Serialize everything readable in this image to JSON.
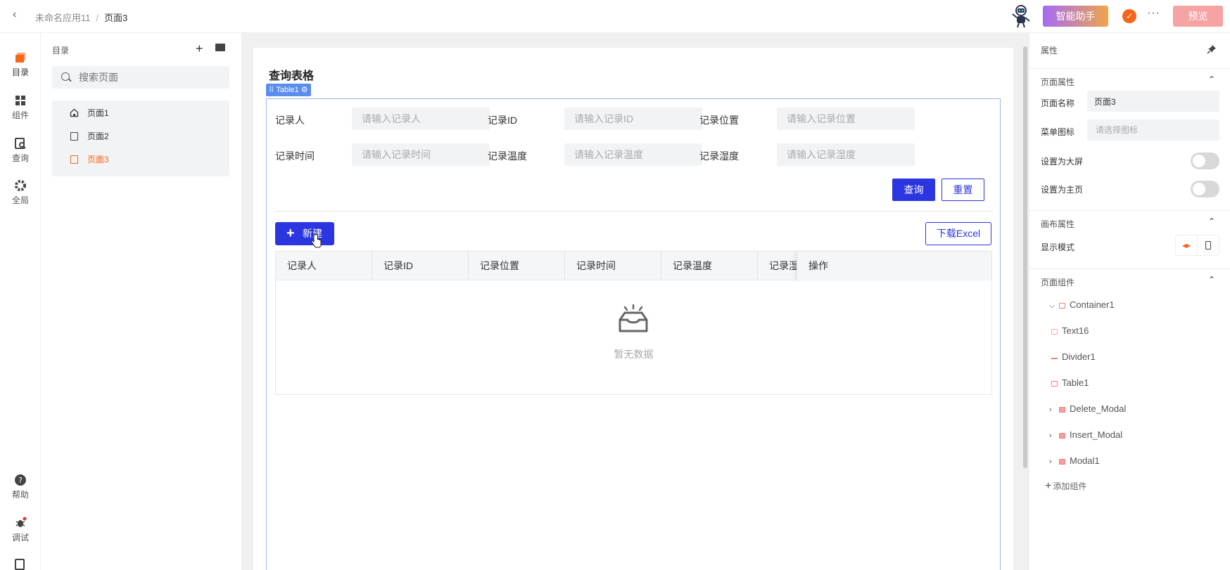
{
  "header": {
    "back_icon": "chevron-left-icon",
    "app_name": "未命名应用11",
    "separator": "/",
    "page_name": "页面3",
    "assistant_label": "智能助手",
    "more_label": "···",
    "preview_label": "预览"
  },
  "rail": {
    "items": [
      {
        "label": "目录",
        "icon": "catalog-icon"
      },
      {
        "label": "组件",
        "icon": "grid-icon"
      },
      {
        "label": "查询",
        "icon": "query-icon"
      },
      {
        "label": "全局",
        "icon": "gear-icon"
      },
      {
        "label": "帮助",
        "icon": "help-icon"
      },
      {
        "label": "调试",
        "icon": "bug-icon"
      }
    ]
  },
  "catalog": {
    "title": "目录",
    "search_placeholder": "搜索页面",
    "pages": [
      {
        "label": "页面1",
        "icon": "home-icon"
      },
      {
        "label": "页面2",
        "icon": "file-icon"
      },
      {
        "label": "页面3",
        "icon": "file-icon",
        "active": true
      }
    ]
  },
  "canvas": {
    "title": "查询表格",
    "tag": "Table1",
    "form": {
      "fields": [
        {
          "label": "记录人",
          "placeholder": "请输入记录人"
        },
        {
          "label": "记录ID",
          "placeholder": "请输入记录ID"
        },
        {
          "label": "记录位置",
          "placeholder": "请输入记录位置"
        },
        {
          "label": "记录时间",
          "placeholder": "请输入记录时间"
        },
        {
          "label": "记录温度",
          "placeholder": "请输入记录温度"
        },
        {
          "label": "记录湿度",
          "placeholder": "请输入记录湿度"
        }
      ],
      "query_label": "查询",
      "reset_label": "重置"
    },
    "new_label": "新建",
    "excel_label": "下载Excel",
    "table": {
      "columns": [
        "记录人",
        "记录ID",
        "记录位置",
        "记录时间",
        "记录温度",
        "记录湿度"
      ],
      "action_column": "操作",
      "empty_text": "暂无数据"
    }
  },
  "props": {
    "title": "属性",
    "page_section": "页面属性",
    "page_name_label": "页面名称",
    "page_name_value": "页面3",
    "menu_icon_label": "菜单图标",
    "menu_icon_placeholder": "请选择图标",
    "big_screen_label": "设置为大屏",
    "home_label": "设置为主页",
    "canvas_section": "画布属性",
    "display_mode_label": "显示模式",
    "components_section": "页面组件",
    "tree": [
      {
        "label": "Container1",
        "expandable": true,
        "expanded": true
      },
      {
        "label": "Text16",
        "expandable": false
      },
      {
        "label": "Divider1",
        "expandable": false
      },
      {
        "label": "Table1",
        "expandable": false
      },
      {
        "label": "Delete_Modal",
        "expandable": true
      },
      {
        "label": "Insert_Modal",
        "expandable": true
      },
      {
        "label": "Modal1",
        "expandable": true
      }
    ],
    "add_component_label": "添加组件"
  },
  "colors": {
    "primary": "#2b36e0",
    "accent": "#f5661a",
    "preview": "#f5a3a3"
  }
}
